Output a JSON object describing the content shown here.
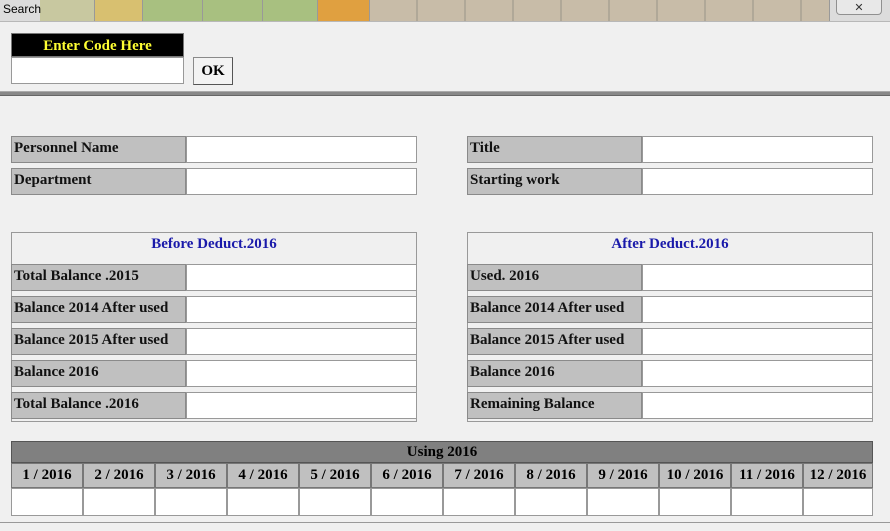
{
  "window": {
    "title": "Search",
    "close_glyph": "✕"
  },
  "code": {
    "label": "Enter Code Here",
    "value": "",
    "ok_label": "OK"
  },
  "info": {
    "personnel_name_label": "Personnel Name",
    "department_label": "Department",
    "title_label": "Title",
    "starting_work_label": "Starting work",
    "personnel_name_value": "",
    "department_value": "",
    "title_value": "",
    "starting_work_value": ""
  },
  "before": {
    "heading": "Before Deduct.2016",
    "rows": [
      {
        "label": "Total Balance .2015",
        "value": ""
      },
      {
        "label": "Balance 2014 After used",
        "value": ""
      },
      {
        "label": "Balance 2015  After used",
        "value": ""
      },
      {
        "label": "Balance 2016",
        "value": ""
      },
      {
        "label": "Total Balance .2016",
        "value": ""
      }
    ]
  },
  "after": {
    "heading": "After Deduct.2016",
    "rows": [
      {
        "label": "Used. 2016",
        "value": ""
      },
      {
        "label": "Balance 2014 After used",
        "value": ""
      },
      {
        "label": "Balance 2015  After used",
        "value": ""
      },
      {
        "label": "Balance 2016",
        "value": ""
      },
      {
        "label": "Remaining Balance",
        "value": ""
      }
    ]
  },
  "using": {
    "heading": "Using 2016",
    "months": [
      {
        "label": "1 / 2016",
        "value": ""
      },
      {
        "label": "2 / 2016",
        "value": ""
      },
      {
        "label": "3 / 2016",
        "value": ""
      },
      {
        "label": "4 / 2016",
        "value": ""
      },
      {
        "label": "5 / 2016",
        "value": ""
      },
      {
        "label": "6 / 2016",
        "value": ""
      },
      {
        "label": "7 / 2016",
        "value": ""
      },
      {
        "label": "8 / 2016",
        "value": ""
      },
      {
        "label": "9 / 2016",
        "value": ""
      },
      {
        "label": "10 / 2016",
        "value": ""
      },
      {
        "label": "11 / 2016",
        "value": ""
      },
      {
        "label": "12 / 2016",
        "value": ""
      }
    ]
  },
  "colors": {
    "code_label_bg": "#000000",
    "code_label_text": "#ffff33",
    "heading_text": "#1a1aaa",
    "label_bg": "#c0c0c0",
    "using_bar": "#808080"
  },
  "icons": {
    "close": "close-icon"
  }
}
